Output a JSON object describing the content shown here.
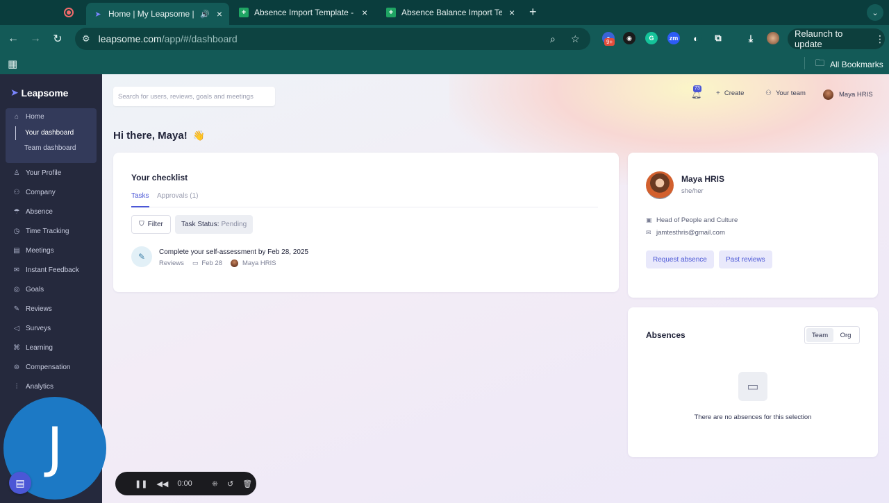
{
  "browser": {
    "tabs": [
      {
        "title": "Home | My Leapsome | Le",
        "active": true
      },
      {
        "title": "Absence Import Template - G",
        "active": false
      },
      {
        "title": "Absence Balance Import Temp",
        "active": false
      }
    ],
    "url_host": "leapsome.com",
    "url_path": "/app/#/dashboard",
    "relaunch_label": "Relaunch to update",
    "extension_badge": "9+",
    "all_bookmarks": "All Bookmarks"
  },
  "app": {
    "brand": "Leapsome",
    "search_placeholder": "Search for users, reviews, goals and meetings",
    "notifications_count": "73",
    "create_label": "Create",
    "your_team_label": "Your team",
    "user_name": "Maya HRIS"
  },
  "sidebar": {
    "home": "Home",
    "your_dashboard": "Your dashboard",
    "team_dashboard": "Team dashboard",
    "items": [
      "Your Profile",
      "Company",
      "Absence",
      "Time Tracking",
      "Meetings",
      "Instant Feedback",
      "Goals",
      "Reviews",
      "Surveys",
      "Learning",
      "Compensation",
      "Analytics"
    ]
  },
  "greeting": {
    "text": "Hi there, Maya!",
    "emoji": "👋"
  },
  "checklist": {
    "title": "Your checklist",
    "tab_tasks": "Tasks",
    "tab_approvals": "Approvals (1)",
    "filter_label": "Filter",
    "status_key": "Task Status:",
    "status_value": "Pending",
    "task": {
      "title": "Complete your self-assessment by Feb 28, 2025",
      "category": "Reviews",
      "due": "Feb 28",
      "owner": "Maya HRIS"
    }
  },
  "profile": {
    "name": "Maya HRIS",
    "pronouns": "she/her",
    "job_title": "Head of People and Culture",
    "email": "jamtesthris@gmail.com",
    "request_absence": "Request absence",
    "past_reviews": "Past reviews"
  },
  "absences": {
    "title": "Absences",
    "seg_team": "Team",
    "seg_org": "Org",
    "empty_text": "There are no absences for this selection"
  },
  "overlay": {
    "webcam_initial": "J",
    "recording_time": "0:00"
  }
}
